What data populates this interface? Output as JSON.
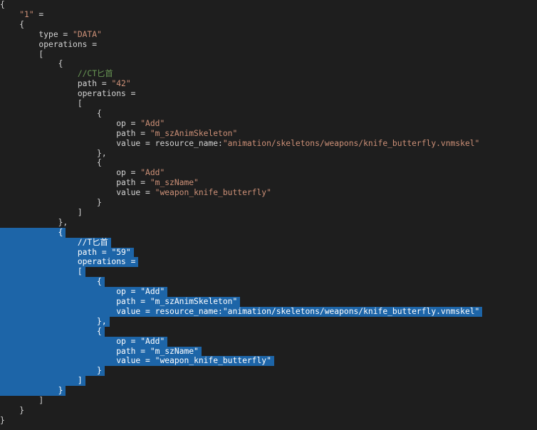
{
  "editor": {
    "lines": [
      {
        "id": "l01",
        "text": "{"
      },
      {
        "id": "l02",
        "text": "    \"1\" ="
      },
      {
        "id": "l03",
        "text": "    {"
      },
      {
        "id": "l04",
        "text": "        type = \"DATA\""
      },
      {
        "id": "l05",
        "text": "        operations ="
      },
      {
        "id": "l06",
        "text": "        ["
      },
      {
        "id": "l07",
        "text": "            {"
      },
      {
        "id": "l08",
        "text": "                //CT匕首"
      },
      {
        "id": "l09",
        "text": "                path = \"42\""
      },
      {
        "id": "l10",
        "text": "                operations ="
      },
      {
        "id": "l11",
        "text": "                ["
      },
      {
        "id": "l12",
        "text": "                    {"
      },
      {
        "id": "l13",
        "text": "                        op = \"Add\""
      },
      {
        "id": "l14",
        "text": "                        path = \"m_szAnimSkeleton\""
      },
      {
        "id": "l15",
        "text": "                        value = resource_name:\"animation/skeletons/weapons/knife_butterfly.vnmskel\""
      },
      {
        "id": "l16",
        "text": "                    },"
      },
      {
        "id": "l17",
        "text": "                    {"
      },
      {
        "id": "l18",
        "text": "                        op = \"Add\""
      },
      {
        "id": "l19",
        "text": "                        path = \"m_szName\""
      },
      {
        "id": "l20",
        "text": "                        value = \"weapon_knife_butterfly\""
      },
      {
        "id": "l21",
        "text": "                    }"
      },
      {
        "id": "l22",
        "text": "                ]"
      },
      {
        "id": "l23",
        "text": "            },"
      },
      {
        "id": "l24",
        "text": "            {"
      },
      {
        "id": "l25",
        "text": "                //T匕首"
      },
      {
        "id": "l26",
        "text": "                path = \"59\""
      },
      {
        "id": "l27",
        "text": "                operations ="
      },
      {
        "id": "l28",
        "text": "                ["
      },
      {
        "id": "l29",
        "text": "                    {"
      },
      {
        "id": "l30",
        "text": "                        op = \"Add\""
      },
      {
        "id": "l31",
        "text": "                        path = \"m_szAnimSkeleton\""
      },
      {
        "id": "l32",
        "text": "                        value = resource_name:\"animation/skeletons/weapons/knife_butterfly.vnmskel\""
      },
      {
        "id": "l33",
        "text": "                    },"
      },
      {
        "id": "l34",
        "text": "                    {"
      },
      {
        "id": "l35",
        "text": "                        op = \"Add\""
      },
      {
        "id": "l36",
        "text": "                        path = \"m_szName\""
      },
      {
        "id": "l37",
        "text": "                        value = \"weapon_knife_butterfly\""
      },
      {
        "id": "l38",
        "text": "                    }"
      },
      {
        "id": "l39",
        "text": "                ]"
      },
      {
        "id": "l40",
        "text": "            }"
      },
      {
        "id": "l41",
        "text": "        ]"
      },
      {
        "id": "l42",
        "text": "    }"
      },
      {
        "id": "l43",
        "text": "}"
      }
    ],
    "colors": {
      "background": "#1e1e1e",
      "text": "#d4d4d4",
      "string": "#ce9178",
      "comment": "#6a9955",
      "selection": "#1d65a8"
    }
  }
}
